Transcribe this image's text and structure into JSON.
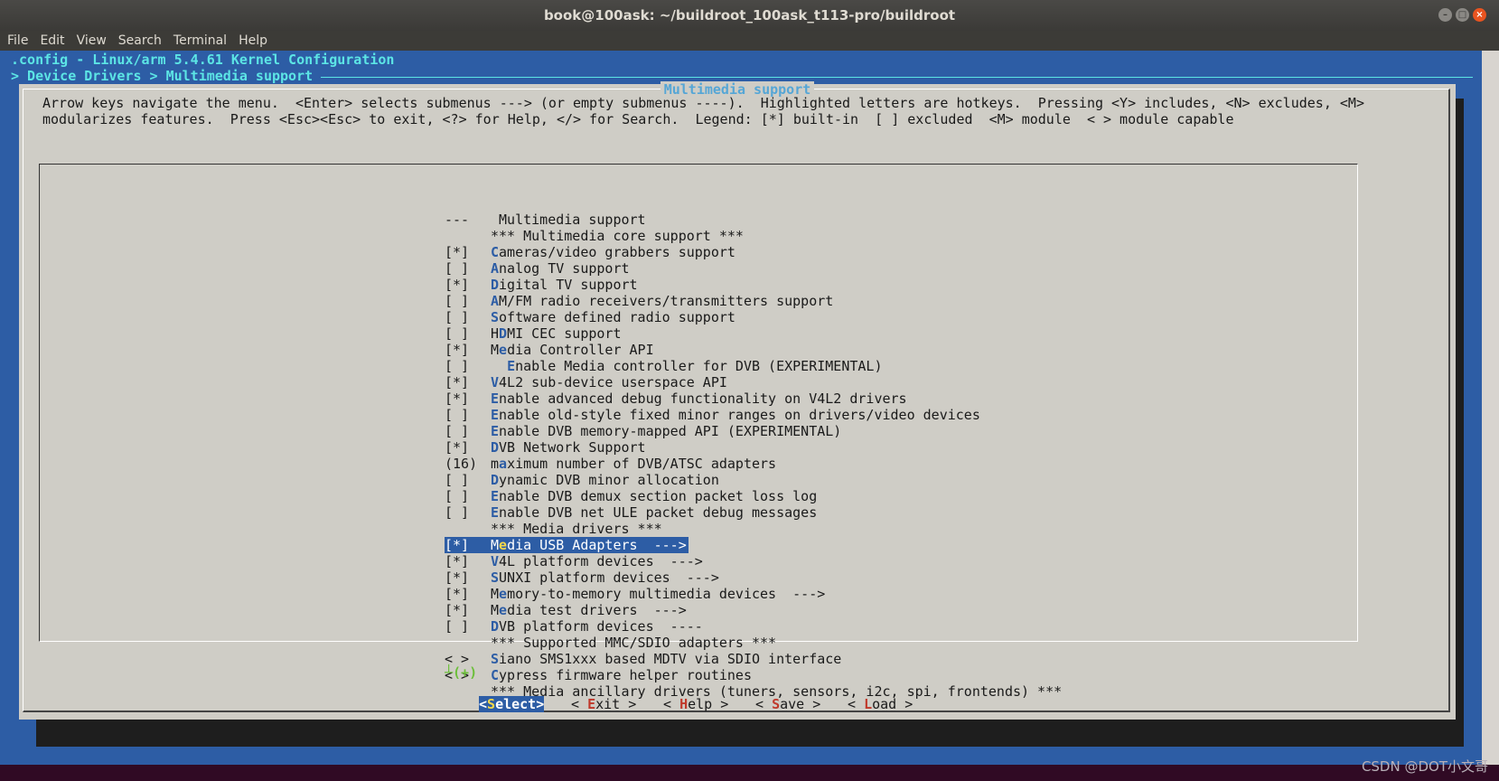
{
  "window": {
    "title": "book@100ask: ~/buildroot_100ask_t113-pro/buildroot",
    "buttons": [
      "–",
      "□",
      "×"
    ]
  },
  "menubar": [
    "File",
    "Edit",
    "View",
    "Search",
    "Terminal",
    "Help"
  ],
  "terminal": {
    "config_line": ".config - Linux/arm 5.4.61 Kernel Configuration",
    "breadcrumb": "> Device Drivers > Multimedia support"
  },
  "dialog": {
    "title": "Multimedia support",
    "help_line1": "Arrow keys navigate the menu.  <Enter> selects submenus ---> (or empty submenus ----).  Highlighted letters are hotkeys.  Pressing <Y> includes, <N> excludes, <M>",
    "help_line2": "modularizes features.  Press <Esc><Esc> to exit, <?> for Help, </> for Search.  Legend: [*] built-in  [ ] excluded  <M> module  < > module capable",
    "items": [
      {
        "chk": "---",
        "pre": "",
        "hot": "",
        "rest": " Multimedia support",
        "sel": false,
        "indent": 0
      },
      {
        "chk": "",
        "pre": "*** Multimedia core support ***",
        "hot": "",
        "rest": "",
        "sel": false,
        "indent": 0
      },
      {
        "chk": "[*]",
        "pre": "",
        "hot": "C",
        "rest": "ameras/video grabbers support",
        "sel": false,
        "indent": 0
      },
      {
        "chk": "[ ]",
        "pre": "",
        "hot": "A",
        "rest": "nalog TV support",
        "sel": false,
        "indent": 0
      },
      {
        "chk": "[*]",
        "pre": "",
        "hot": "D",
        "rest": "igital TV support",
        "sel": false,
        "indent": 0
      },
      {
        "chk": "[ ]",
        "pre": "",
        "hot": "A",
        "rest": "M/FM radio receivers/transmitters support",
        "sel": false,
        "indent": 0
      },
      {
        "chk": "[ ]",
        "pre": "",
        "hot": "S",
        "rest": "oftware defined radio support",
        "sel": false,
        "indent": 0
      },
      {
        "chk": "[ ]",
        "pre": "H",
        "hot": "D",
        "rest": "MI CEC support",
        "sel": false,
        "indent": 0
      },
      {
        "chk": "[*]",
        "pre": "M",
        "hot": "e",
        "rest": "dia Controller API",
        "sel": false,
        "indent": 0
      },
      {
        "chk": "[ ]",
        "pre": "  ",
        "hot": "E",
        "rest": "nable Media controller for DVB (EXPERIMENTAL)",
        "sel": false,
        "indent": 0
      },
      {
        "chk": "[*]",
        "pre": "",
        "hot": "V",
        "rest": "4L2 sub-device userspace API",
        "sel": false,
        "indent": 0
      },
      {
        "chk": "[*]",
        "pre": "",
        "hot": "E",
        "rest": "nable advanced debug functionality on V4L2 drivers",
        "sel": false,
        "indent": 0
      },
      {
        "chk": "[ ]",
        "pre": "",
        "hot": "E",
        "rest": "nable old-style fixed minor ranges on drivers/video devices",
        "sel": false,
        "indent": 0
      },
      {
        "chk": "[ ]",
        "pre": "",
        "hot": "E",
        "rest": "nable DVB memory-mapped API (EXPERIMENTAL)",
        "sel": false,
        "indent": 0
      },
      {
        "chk": "[*]",
        "pre": "",
        "hot": "D",
        "rest": "VB Network Support",
        "sel": false,
        "indent": 0
      },
      {
        "chk": "(16)",
        "pre": "m",
        "hot": "a",
        "rest": "ximum number of DVB/ATSC adapters",
        "sel": false,
        "indent": 0
      },
      {
        "chk": "[ ]",
        "pre": "",
        "hot": "D",
        "rest": "ynamic DVB minor allocation",
        "sel": false,
        "indent": 0
      },
      {
        "chk": "[ ]",
        "pre": "",
        "hot": "E",
        "rest": "nable DVB demux section packet loss log",
        "sel": false,
        "indent": 0
      },
      {
        "chk": "[ ]",
        "pre": "",
        "hot": "E",
        "rest": "nable DVB net ULE packet debug messages",
        "sel": false,
        "indent": 0
      },
      {
        "chk": "",
        "pre": "*** Media drivers ***",
        "hot": "",
        "rest": "",
        "sel": false,
        "indent": 0
      },
      {
        "chk": "[*]",
        "pre": "M",
        "hot": "e",
        "rest": "dia USB Adapters  --->",
        "sel": true,
        "indent": 0
      },
      {
        "chk": "[*]",
        "pre": "",
        "hot": "V",
        "rest": "4L platform devices  --->",
        "sel": false,
        "indent": 0
      },
      {
        "chk": "[*]",
        "pre": "",
        "hot": "S",
        "rest": "UNXI platform devices  --->",
        "sel": false,
        "indent": 0
      },
      {
        "chk": "[*]",
        "pre": "M",
        "hot": "e",
        "rest": "mory-to-memory multimedia devices  --->",
        "sel": false,
        "indent": 0
      },
      {
        "chk": "[*]",
        "pre": "M",
        "hot": "e",
        "rest": "dia test drivers  --->",
        "sel": false,
        "indent": 0
      },
      {
        "chk": "[ ]",
        "pre": "",
        "hot": "D",
        "rest": "VB platform devices  ----",
        "sel": false,
        "indent": 0
      },
      {
        "chk": "",
        "pre": "*** Supported MMC/SDIO adapters ***",
        "hot": "",
        "rest": "",
        "sel": false,
        "indent": 0
      },
      {
        "chk": "< >",
        "pre": "",
        "hot": "S",
        "rest": "iano SMS1xxx based MDTV via SDIO interface",
        "sel": false,
        "indent": 0
      },
      {
        "chk": "< >",
        "pre": "",
        "hot": "C",
        "rest": "ypress firmware helper routines",
        "sel": false,
        "indent": 0
      },
      {
        "chk": "",
        "pre": "*** Media ancillary drivers (tuners, sensors, i2c, spi, frontends) ***",
        "hot": "",
        "rest": "",
        "sel": false,
        "indent": 0
      }
    ],
    "more_indicator": "┴(+)",
    "buttons": [
      {
        "pre": "<",
        "key": "S",
        "rest": "elect>",
        "active": true
      },
      {
        "pre": "< ",
        "key": "E",
        "rest": "xit >",
        "active": false
      },
      {
        "pre": "< ",
        "key": "H",
        "rest": "elp >",
        "active": false
      },
      {
        "pre": "< ",
        "key": "S",
        "rest": "ave >",
        "active": false
      },
      {
        "pre": "< ",
        "key": "L",
        "rest": "oad >",
        "active": false
      }
    ]
  },
  "watermark": "CSDN @DOT小文哥",
  "colors": {
    "terminal_blue": "#2d5da5",
    "cyan_text": "#5ce5e5",
    "dialog_bg": "#cfcdc6",
    "hotkey_red": "#c0392b",
    "hotkey_yellow": "#f6d94a"
  }
}
